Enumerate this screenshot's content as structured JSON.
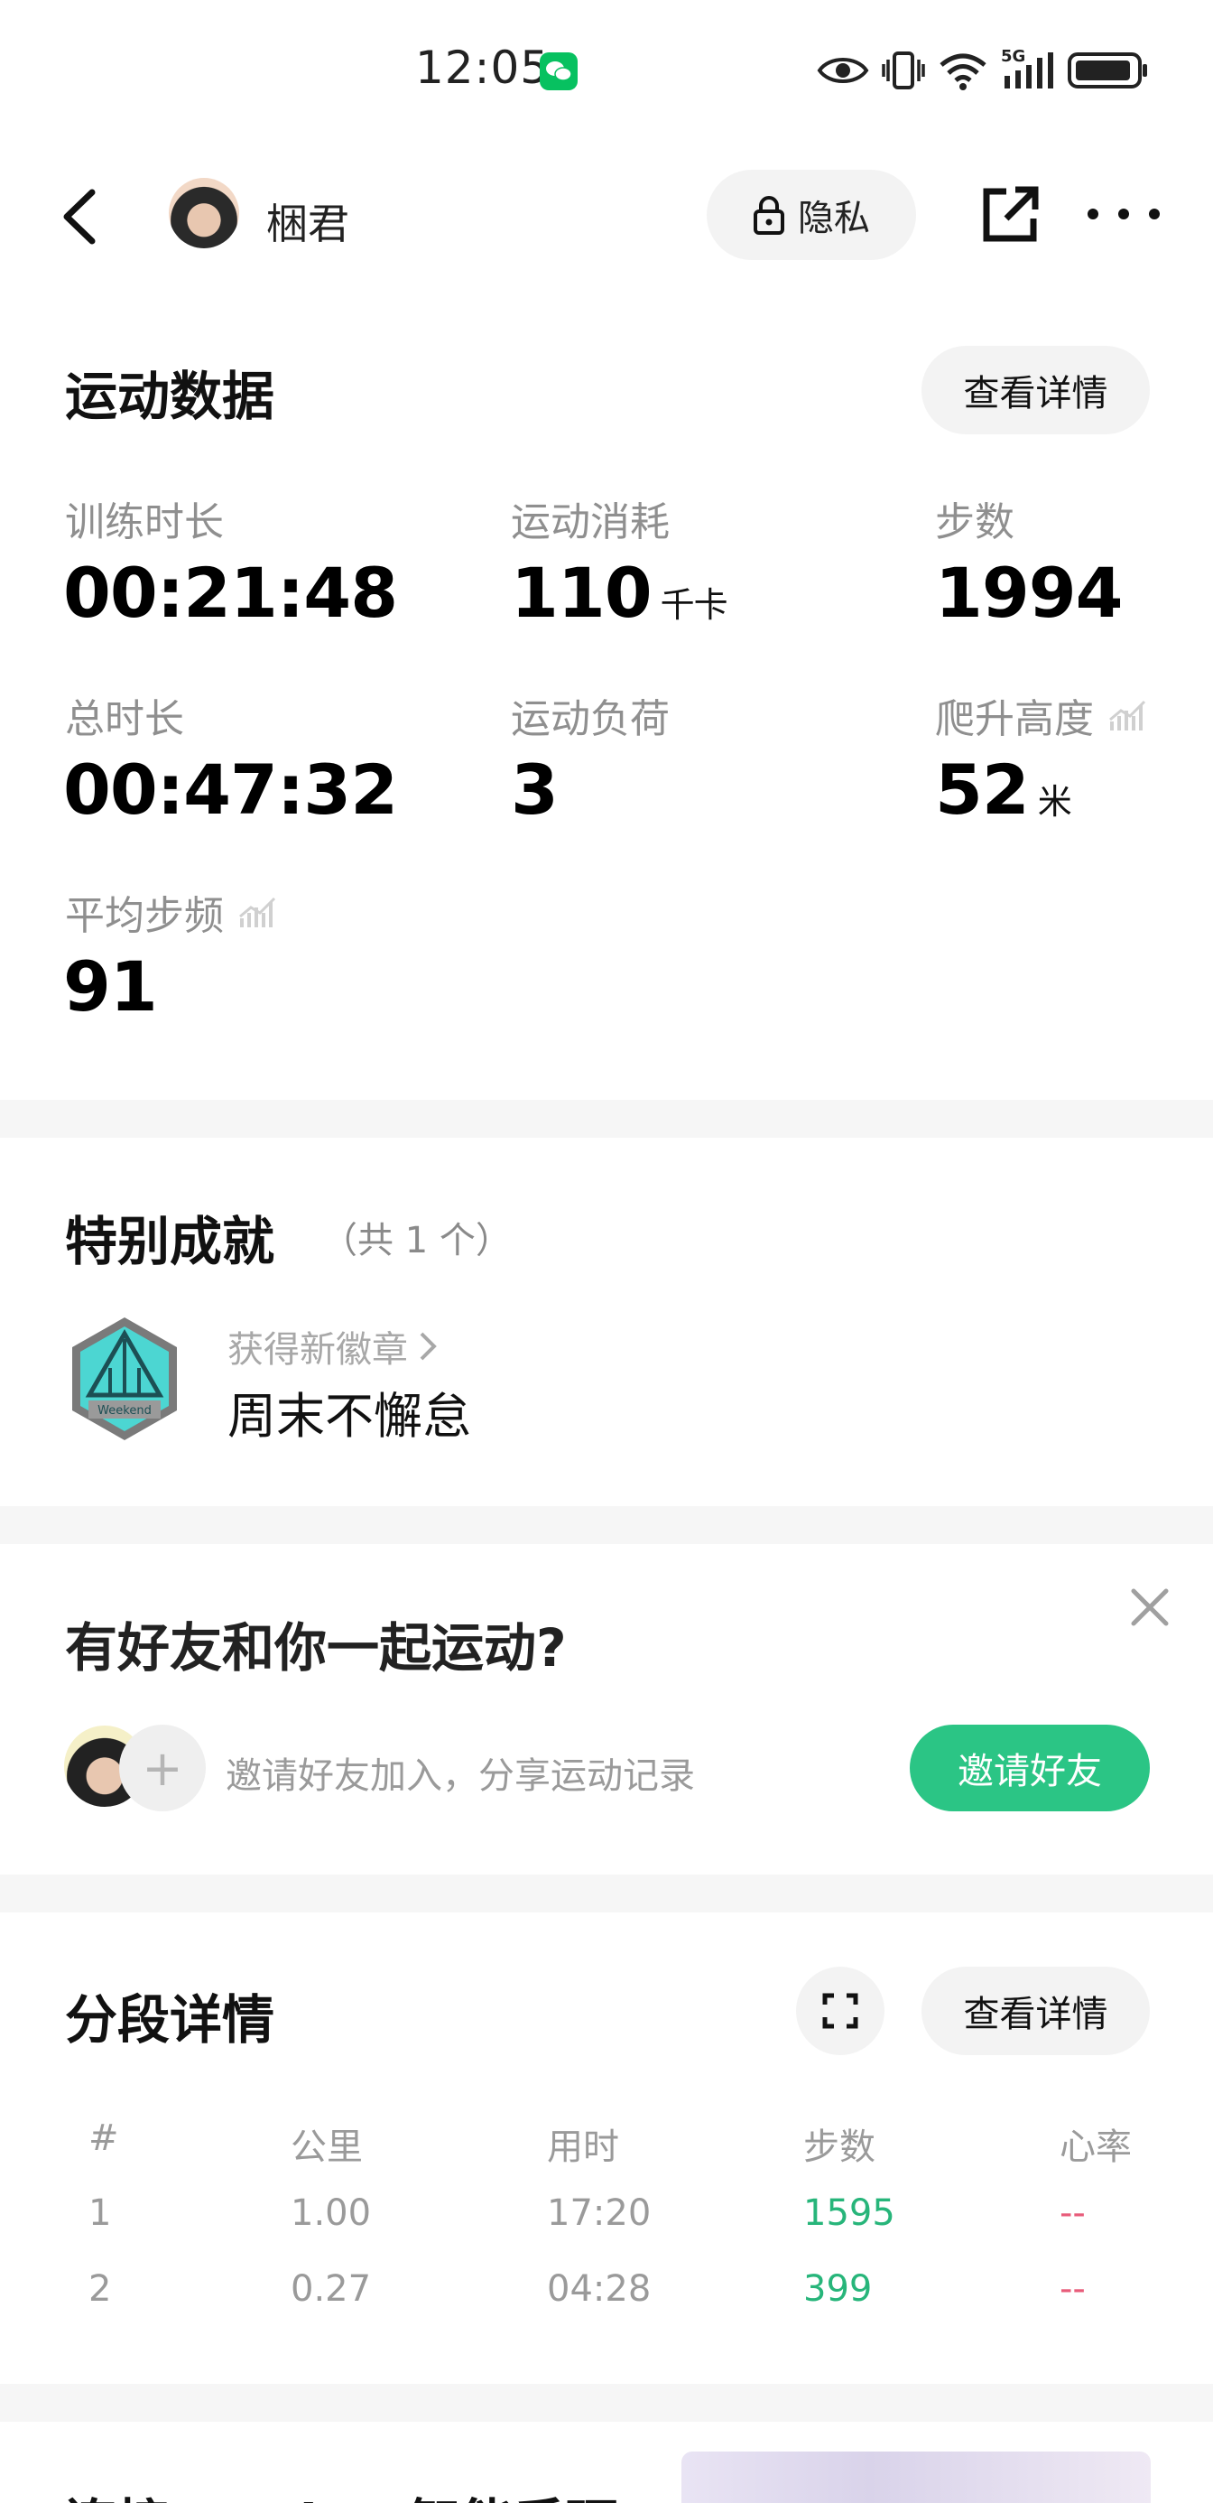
{
  "status_bar": {
    "time": "12:05",
    "network": "5G"
  },
  "header": {
    "username": "梱君",
    "privacy_label": "隐私"
  },
  "sport_data": {
    "title": "运动数据",
    "detail_button": "查看详情",
    "stats": [
      {
        "label": "训练时长",
        "value": "00:21:48",
        "unit": ""
      },
      {
        "label": "运动消耗",
        "value": "110",
        "unit": "千卡"
      },
      {
        "label": "步数",
        "value": "1994",
        "unit": ""
      },
      {
        "label": "总时长",
        "value": "00:47:32",
        "unit": ""
      },
      {
        "label": "运动负荷",
        "value": "3",
        "unit": ""
      },
      {
        "label": "爬升高度",
        "value": "52",
        "unit": "米"
      },
      {
        "label": "平均步频",
        "value": "91",
        "unit": ""
      }
    ]
  },
  "achievements": {
    "title": "特别成就",
    "count_text": "（共 1 个）",
    "subtitle": "获得新徽章",
    "badge_name": "周末不懈怠",
    "badge_text": "Weekend"
  },
  "friends": {
    "title": "有好友和你一起运动?",
    "invite_text": "邀请好友加入，分享运动记录",
    "invite_button": "邀请好友"
  },
  "segments": {
    "title": "分段详情",
    "detail_button": "查看详情",
    "columns": [
      "#",
      "公里",
      "用时",
      "步数",
      "心率"
    ],
    "rows": [
      {
        "index": "1",
        "km": "1.00",
        "time": "17:20",
        "steps": "1595",
        "hr": "--"
      },
      {
        "index": "2",
        "km": "0.27",
        "time": "04:28",
        "steps": "399",
        "hr": "--"
      }
    ]
  },
  "bottom_card": {
    "title": "连接 Haylou 智能手环"
  },
  "colors": {
    "accent": "#2bc585",
    "steps": "#27b57a",
    "heart_rate": "#e85c7a",
    "muted": "#8f8f8f"
  }
}
